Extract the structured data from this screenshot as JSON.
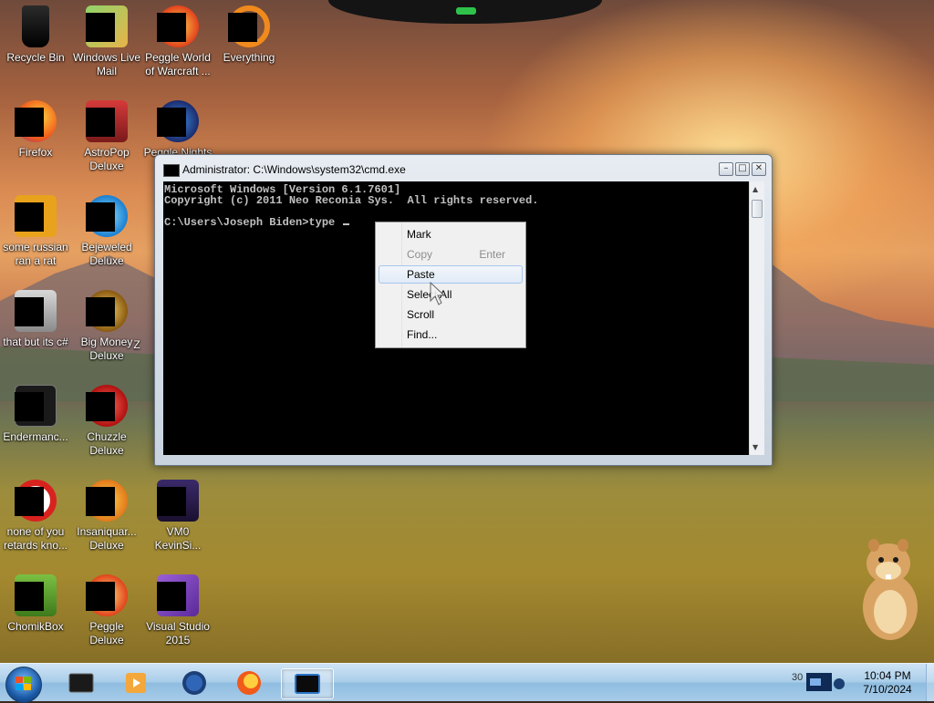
{
  "desktop": {
    "icons": [
      {
        "id": "recycle-bin",
        "label": "Recycle Bin"
      },
      {
        "id": "windows-live-mail",
        "label": "Windows Live\nMail"
      },
      {
        "id": "peggle-world-of-warcraft",
        "label": "Peggle World\nof Warcraft ..."
      },
      {
        "id": "everything",
        "label": "Everything"
      },
      {
        "id": "firefox",
        "label": "Firefox"
      },
      {
        "id": "astropop-deluxe",
        "label": "AstroPop\nDeluxe"
      },
      {
        "id": "peggle-nights",
        "label": "Peggle Nights"
      },
      {
        "id": "some-russian",
        "label": "some russian\nran a rat"
      },
      {
        "id": "bejeweled-deluxe",
        "label": "Bejeweled\nDeluxe"
      },
      {
        "id": "that-but-its-c",
        "label": "that but its c#"
      },
      {
        "id": "big-money-deluxe",
        "label": "Big Money\nDeluxe"
      },
      {
        "id": "partial-z",
        "label": "Z"
      },
      {
        "id": "endermanc",
        "label": "Endermanc..."
      },
      {
        "id": "chuzzle-deluxe",
        "label": "Chuzzle\nDeluxe"
      },
      {
        "id": "none-of-you",
        "label": "none of you\nretards kno..."
      },
      {
        "id": "insaniquarium-deluxe",
        "label": "Insaniquar...\nDeluxe"
      },
      {
        "id": "vm0",
        "label": "VM0\nKevinSi..."
      },
      {
        "id": "chomikbox",
        "label": "ChomikBox"
      },
      {
        "id": "peggle-deluxe",
        "label": "Peggle Deluxe"
      },
      {
        "id": "visual-studio-2015",
        "label": "Visual Studio\n2015"
      }
    ]
  },
  "cmd_window": {
    "title": "Administrator: C:\\Windows\\system32\\cmd.exe",
    "buttons": {
      "minimize": "–",
      "maximize": "□",
      "close": "✕"
    },
    "lines": [
      "Microsoft Windows [Version 6.1.7601]",
      "Copyright (c) 2011 Neo Reconia Sys.  All rights reserved.",
      "",
      "C:\\Users\\Joseph Biden>type "
    ]
  },
  "context_menu": {
    "items": [
      {
        "label": "Mark",
        "shortcut": "",
        "disabled": false,
        "hover": false
      },
      {
        "label": "Copy",
        "shortcut": "Enter",
        "disabled": true,
        "hover": false
      },
      {
        "label": "Paste",
        "shortcut": "",
        "disabled": false,
        "hover": true
      },
      {
        "label": "Select All",
        "shortcut": "",
        "disabled": false,
        "hover": false
      },
      {
        "label": "Scroll",
        "shortcut": "",
        "disabled": false,
        "hover": false
      },
      {
        "label": "Find...",
        "shortcut": "",
        "disabled": false,
        "hover": false
      }
    ]
  },
  "taskbar": {
    "tray_number": "30",
    "clock": {
      "time": "10:04 PM",
      "date": "7/10/2024"
    }
  },
  "colors": {
    "console_bg": "#000000",
    "console_text": "#c0c0c0",
    "menu_hover_border": "#a8c6ee"
  }
}
